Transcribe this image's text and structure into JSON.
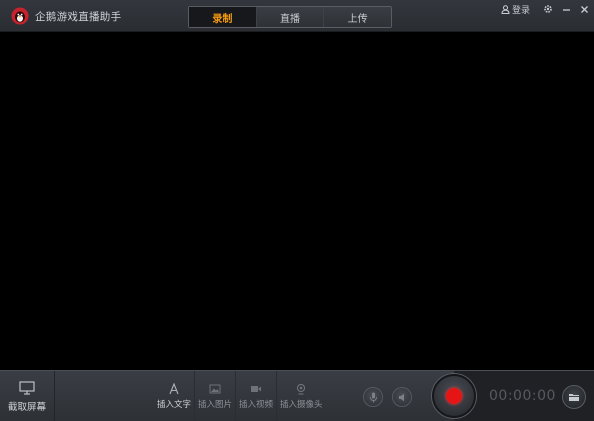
{
  "app": {
    "title": "企鹅游戏直播助手",
    "accent_color": "#f29a12",
    "record_color": "#e51515"
  },
  "tabs": [
    {
      "label": "录制",
      "active": true
    },
    {
      "label": "直播",
      "active": false
    },
    {
      "label": "上传",
      "active": false
    }
  ],
  "window": {
    "login_label": "登录",
    "icons": [
      "user-icon",
      "gear-icon",
      "minimize-icon",
      "close-icon"
    ]
  },
  "bottombar": {
    "capture_label": "截取屏幕",
    "insert": [
      {
        "label": "插入文字",
        "icon": "text-icon"
      },
      {
        "label": "插入图片",
        "icon": "image-icon"
      },
      {
        "label": "插入视频",
        "icon": "video-icon"
      },
      {
        "label": "插入摄像头",
        "icon": "camera-icon"
      }
    ],
    "timer": "00:00:00"
  }
}
